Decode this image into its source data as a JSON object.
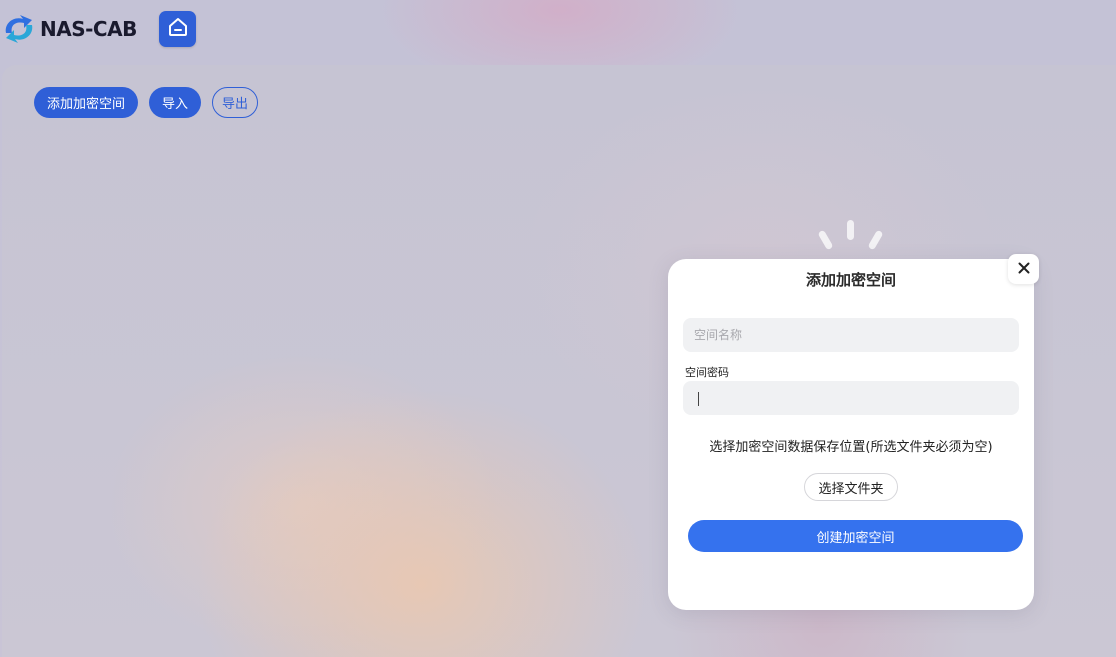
{
  "app": {
    "title": "NAS-CAB",
    "home_icon": "home-icon"
  },
  "toolbar": {
    "add_label": "添加加密空间",
    "import_label": "导入",
    "export_label": "导出"
  },
  "modal": {
    "title": "添加加密空间",
    "close_icon": "close-icon",
    "space_name_placeholder": "空间名称",
    "space_name_value": "",
    "password_label": "空间密码",
    "password_value": "",
    "folder_hint": "选择加密空间数据保存位置(所选文件夹必须为空)",
    "choose_folder_label": "选择文件夹",
    "create_label": "创建加密空间"
  },
  "colors": {
    "primary": "#2f5fd7",
    "create_button": "#3572ee"
  }
}
